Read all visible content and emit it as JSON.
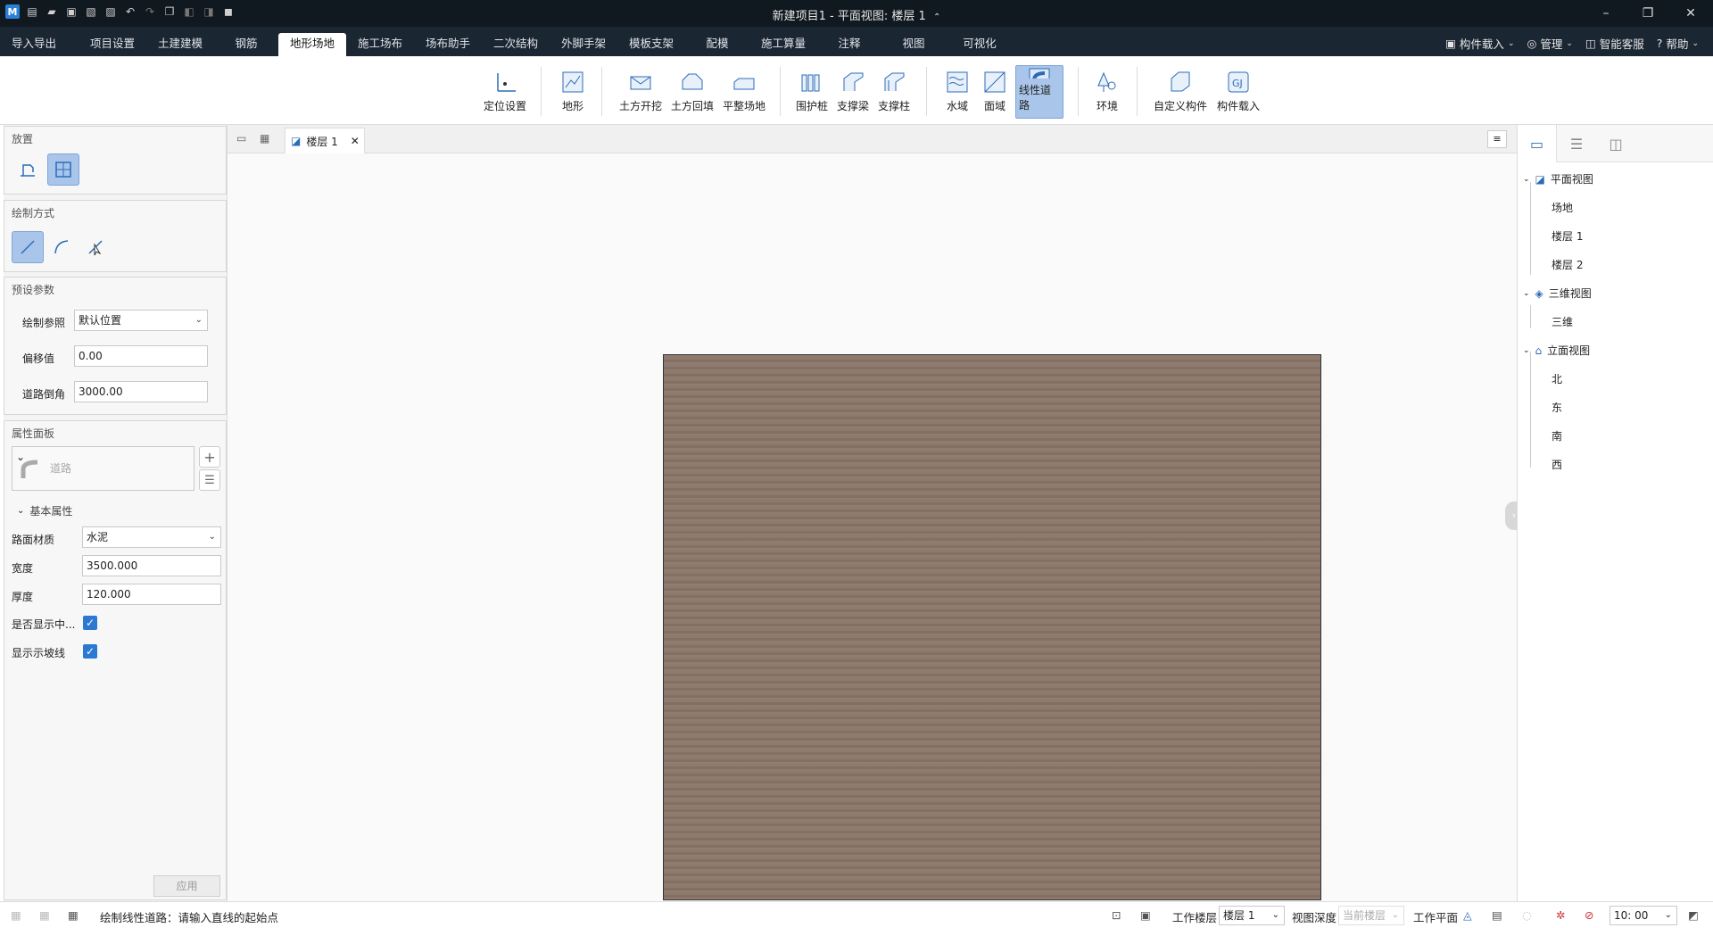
{
  "title_bar": {
    "title": "新建项目1 - 平面视图: 楼层 1",
    "title_suffix": "⌃"
  },
  "menu_tabs": [
    "导入导出",
    "项目设置",
    "土建建模",
    "钢筋",
    "地形场地",
    "施工场布",
    "场布助手",
    "二次结构",
    "外脚手架",
    "模板支架",
    "配模",
    "施工算量",
    "注释",
    "视图",
    "可视化"
  ],
  "active_tab": "地形场地",
  "header_tools": {
    "component_load": "构件载入",
    "manage": "管理",
    "smart_service": "智能客服",
    "help": "帮助"
  },
  "ribbon": {
    "locate": "定位设置",
    "terrain": "地形",
    "excavate": "土方开挖",
    "backfill": "土方回填",
    "level_site": "平整场地",
    "retaining_pile": "围护桩",
    "support_beam": "支撑梁",
    "support_column": "支撑柱",
    "water_area": "水域",
    "surface_area": "面域",
    "linear_road": "线性道路",
    "environment": "环境",
    "custom_component": "自定义构件",
    "component_load": "构件载入"
  },
  "left_panel": {
    "placement": {
      "header": "放置"
    },
    "draw_mode": {
      "header": "绘制方式"
    },
    "preset": {
      "header": "预设参数",
      "draw_ref_label": "绘制参照",
      "draw_ref_value": "默认位置",
      "offset_label": "偏移值",
      "offset_value": "0.00",
      "fillet_label": "道路倒角",
      "fillet_value": "3000.00"
    },
    "props": {
      "header": "属性面板",
      "type_value": "道路",
      "basic_header": "基本属性",
      "material_label": "路面材质",
      "material_value": "水泥",
      "width_label": "宽度",
      "width_value": "3500.000",
      "thickness_label": "厚度",
      "thickness_value": "120.000",
      "show_center_label": "是否显示中...",
      "show_slope_label": "显示示坡线"
    },
    "apply": "应用"
  },
  "doc_tab": {
    "label": "楼层 1",
    "close": "✕"
  },
  "tree": {
    "plan_view": "平面视图",
    "plan_items": [
      "场地",
      "楼层 1",
      "楼层 2"
    ],
    "three_d_view": "三维视图",
    "three_d_items": [
      "三维"
    ],
    "elevation_view": "立面视图",
    "elevation_items": [
      "北",
      "东",
      "南",
      "西"
    ]
  },
  "status": {
    "prompt": "绘制线性道路：请输入直线的起始点",
    "work_floor_label": "工作楼层",
    "work_floor_value": "楼层 1",
    "view_depth_label": "视图深度",
    "view_depth_value": "当前楼层",
    "work_plane_label": "工作平面",
    "scale_value": "10: 00"
  },
  "colors": {
    "titlebar": "#101820",
    "tabbar": "#1b2633",
    "active_button": "#a9c6ea",
    "accent": "#2b79d2",
    "terrain_fill": "#8a7568"
  }
}
